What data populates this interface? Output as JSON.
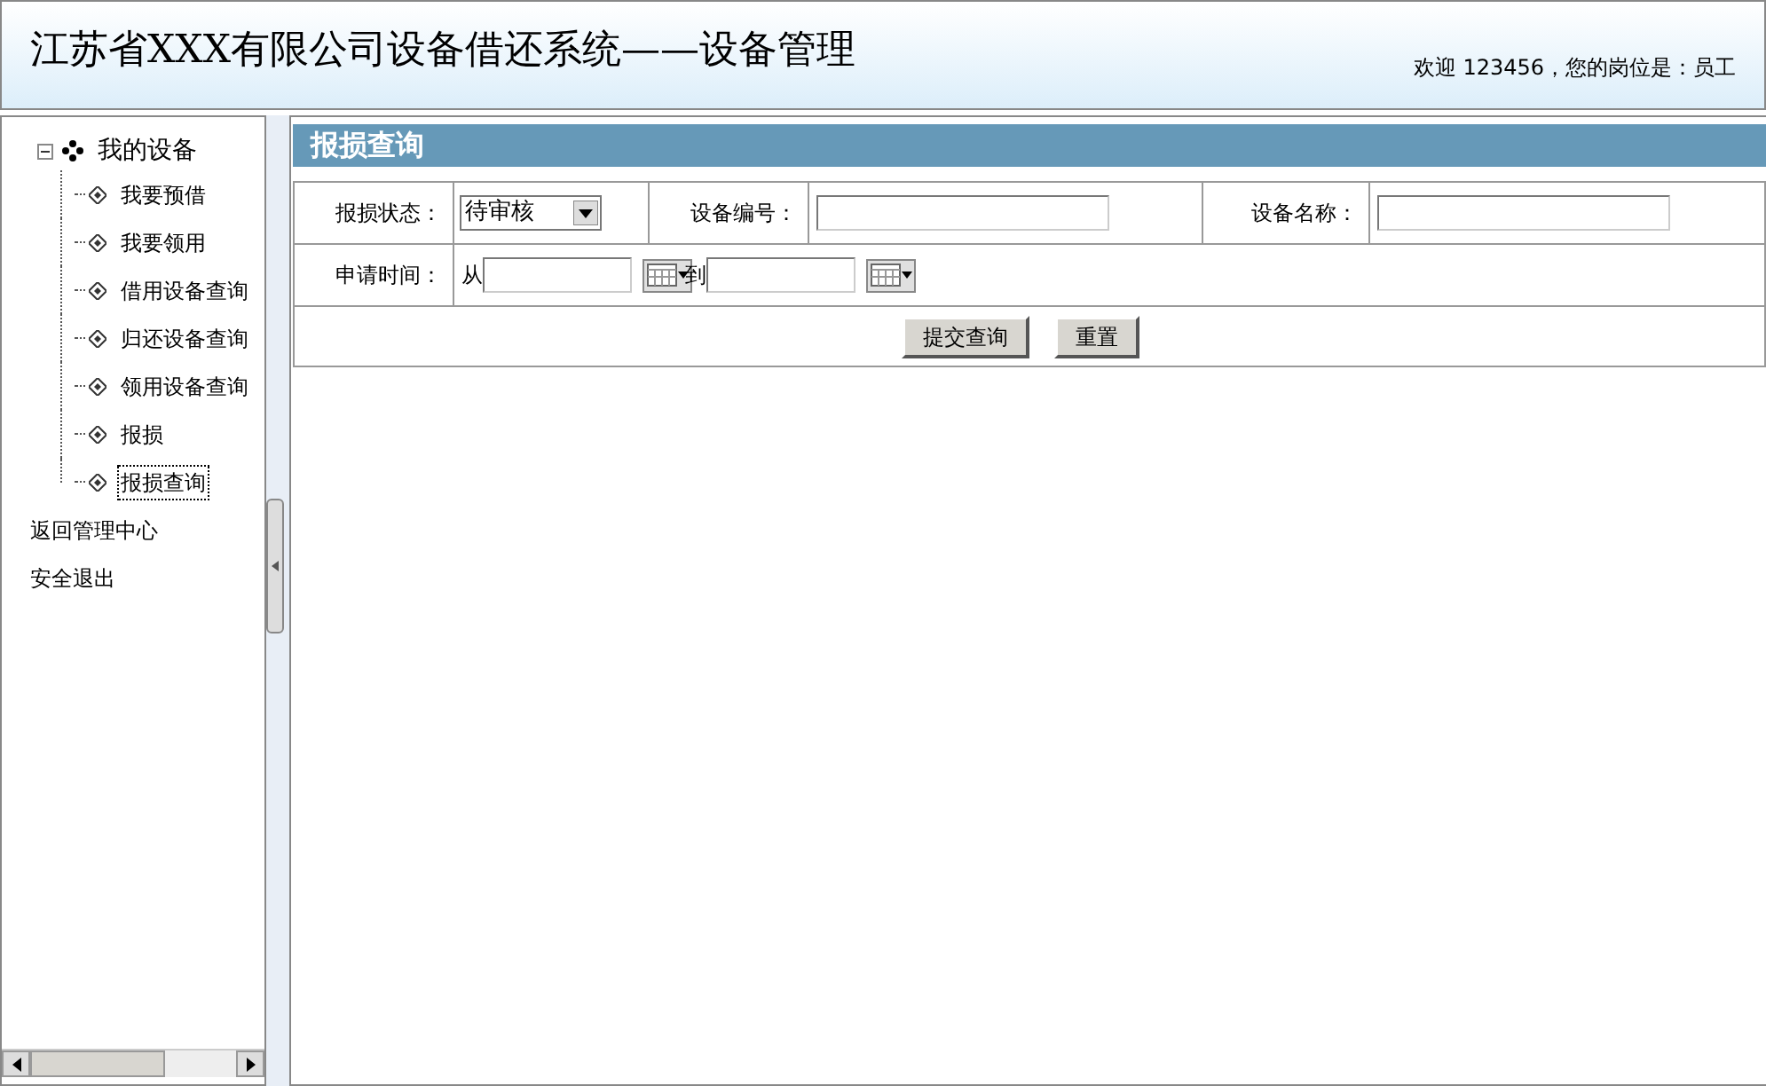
{
  "header": {
    "title": "江苏省XXX有限公司设备借还系统——设备管理",
    "welcome": "欢迎 123456，您的岗位是：员工"
  },
  "sidebar": {
    "tree": [
      {
        "label": "我的设备",
        "expanded": true,
        "children": [
          {
            "label": "我要预借",
            "selected": false
          },
          {
            "label": "我要领用",
            "selected": false
          },
          {
            "label": "借用设备查询",
            "selected": false
          },
          {
            "label": "归还设备查询",
            "selected": false
          },
          {
            "label": "领用设备查询",
            "selected": false
          },
          {
            "label": "报损",
            "selected": false
          },
          {
            "label": "报损查询",
            "selected": true
          }
        ]
      }
    ],
    "links": [
      "返回管理中心",
      "安全退出"
    ]
  },
  "panel": {
    "title": "报损查询",
    "status_label": "报损状态：",
    "status_value": "待审核",
    "code_label": "设备编号：",
    "name_label": "设备名称：",
    "time_label": "申请时间：",
    "from": "从",
    "to": "到",
    "buttons": [
      "提交查询",
      "重置"
    ]
  }
}
